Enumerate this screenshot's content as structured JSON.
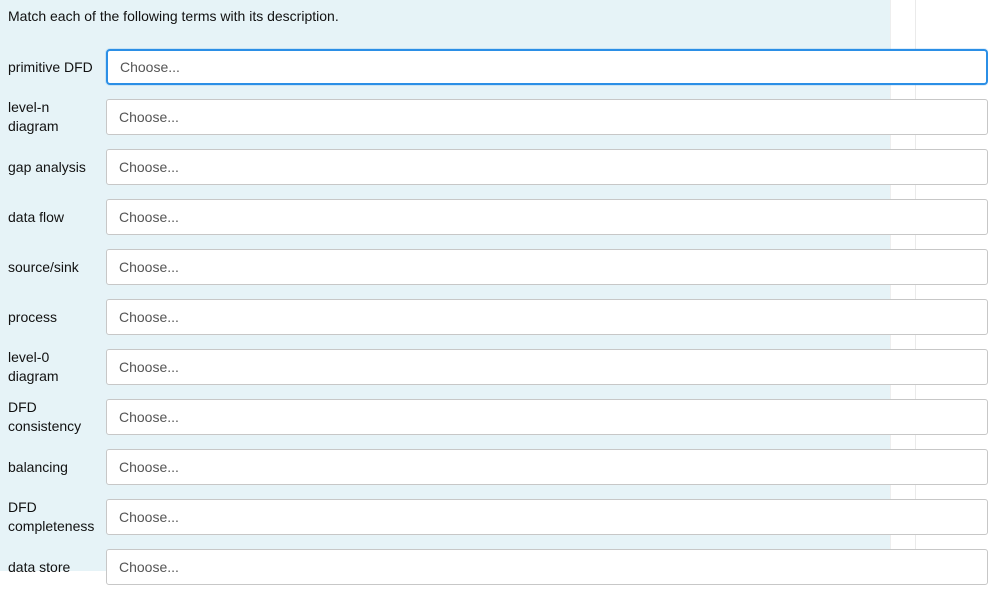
{
  "instruction": "Match each of the following terms with its description.",
  "placeholder": "Choose...",
  "rows": [
    {
      "term": "primitive DFD",
      "focused": true
    },
    {
      "term": "level-n diagram",
      "focused": false
    },
    {
      "term": "gap analysis",
      "focused": false
    },
    {
      "term": "data flow",
      "focused": false
    },
    {
      "term": "source/sink",
      "focused": false
    },
    {
      "term": "process",
      "focused": false
    },
    {
      "term": "level-0 diagram",
      "focused": false
    },
    {
      "term": "DFD consistency",
      "focused": false
    },
    {
      "term": "balancing",
      "focused": false
    },
    {
      "term": "DFD completeness",
      "focused": false
    },
    {
      "term": "data store",
      "focused": false
    }
  ]
}
